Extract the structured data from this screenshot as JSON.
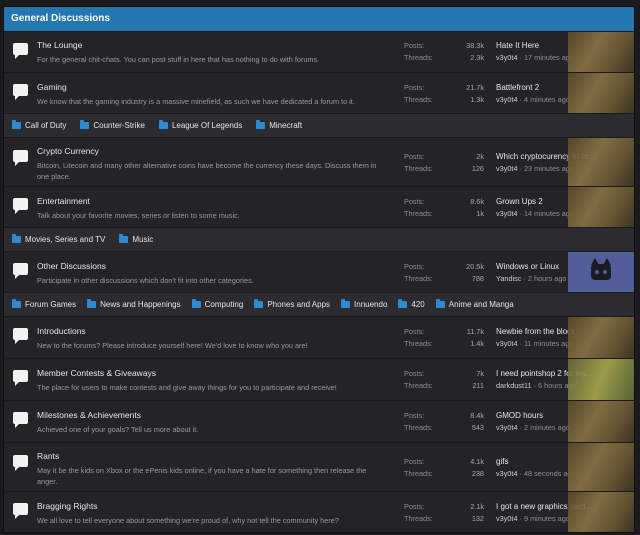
{
  "node": {
    "title": "General Discussions"
  },
  "groups": [
    {
      "forums": [
        {
          "title": "The Lounge",
          "desc": "For the general chit-chats. You can post stuff in here that has nothing to do with forums.",
          "posts": "38.3k",
          "threads": "2.3k",
          "last_title": "Hate It Here",
          "last_user": "v3y0t4",
          "last_time": "17 minutes ago"
        },
        {
          "title": "Gaming",
          "desc": "We know that the gaming industry is a massive minefield, as such we have dedicated a forum to it.",
          "posts": "21.7k",
          "threads": "1.3k",
          "last_title": "Battlefront 2",
          "last_user": "v3y0t4",
          "last_time": "4 minutes ago"
        }
      ],
      "subs": [
        "Call of Duty",
        "Counter-Strike",
        "League Of Legends",
        "Minecraft"
      ]
    },
    {
      "forums": [
        {
          "title": "Crypto Currency",
          "desc": "Bitcoin, Litecoin and many other alternative coins have become the currency these days. Discuss them in one place.",
          "posts": "2k",
          "threads": "126",
          "last_title": "Which cryptocurency to in...",
          "last_user": "v3y0t4",
          "last_time": "23 minutes ago"
        },
        {
          "title": "Entertainment",
          "desc": "Talk about your favorite movies, series or listen to some music.",
          "posts": "8.6k",
          "threads": "1k",
          "last_title": "Grown Ups 2",
          "last_user": "v3y0t4",
          "last_time": "14 minutes ago"
        }
      ],
      "subs": [
        "Movies, Series and TV",
        "Music"
      ]
    },
    {
      "forums": [
        {
          "title": "Other Discussions",
          "desc": "Participate in other discussions which don't fit into other categories.",
          "posts": "20.5k",
          "threads": "788",
          "last_title": "Windows or Linux",
          "last_user": "Yandisc",
          "last_time": "2 hours ago"
        }
      ],
      "subs": [
        "Forum Games",
        "News and Happenings",
        "Computing",
        "Phones and Apps",
        "Innuendo",
        "420",
        "Anime and Manga"
      ]
    },
    {
      "forums": [
        {
          "title": "Introductions",
          "desc": "New to the forums? Please introduce yourself here! We'd love to know who you are!",
          "posts": "11.7k",
          "threads": "1.4k",
          "last_title": "Newbie from the block",
          "last_user": "v3y0t4",
          "last_time": "11 minutes ago"
        },
        {
          "title": "Member Contests & Giveaways",
          "desc": "The place for users to make contests and give away things for you to participate and receive!",
          "posts": "7k",
          "threads": "211",
          "last_title": "I need pointshop 2 for my...",
          "last_user": "darkdust11",
          "last_time": "6 hours ago"
        },
        {
          "title": "Milestones & Achievements",
          "desc": "Achieved one of your goals? Tell us more about it.",
          "posts": "8.4k",
          "threads": "543",
          "last_title": "GMOD hours",
          "last_user": "v3y0t4",
          "last_time": "2 minutes ago"
        },
        {
          "title": "Rants",
          "desc": "May it be the kids on Xbox or the ePenis kids online, if you have a hate for something then release the anger.",
          "posts": "4.1k",
          "threads": "238",
          "last_title": "gifs",
          "last_user": "v3y0t4",
          "last_time": "48 seconds ago"
        },
        {
          "title": "Bragging Rights",
          "desc": "We all love to tell everyone about something we're proud of, why not tell the community here?",
          "posts": "2.1k",
          "threads": "132",
          "last_title": "I got a new graphics card...",
          "last_user": "v3y0t4",
          "last_time": "9 minutes ago"
        }
      ],
      "subs": []
    }
  ],
  "labels": {
    "posts": "Posts:",
    "threads": "Threads:",
    "sep": " · "
  },
  "colors": {
    "header": "#2577b1",
    "folder": "#2f8bd1"
  }
}
